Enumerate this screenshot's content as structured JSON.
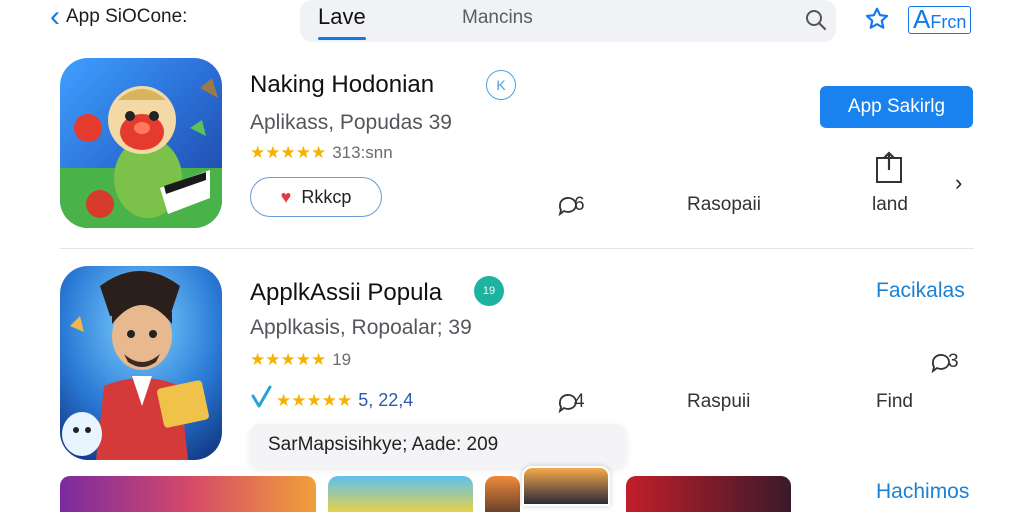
{
  "topbar": {
    "back_label": "App SiOCone:",
    "tabs": [
      {
        "label": "Lave",
        "active": true
      },
      {
        "label": "Mancins",
        "active": false
      }
    ],
    "afirm_big": "A",
    "afirm_small": "Frcn"
  },
  "apps": [
    {
      "title": "Naking Hodonian",
      "badge": "K",
      "subtitle": "Aplikass, Popudas 39",
      "stars": "★★★★★",
      "star_count": "313:snn",
      "fav_label": "Rkkcp",
      "comments": "6",
      "meta_mid": "Rasopaii",
      "meta_right": "land",
      "primary_button": "App Sakirlg"
    },
    {
      "title": "ApplkAssii Popula",
      "badge": "19",
      "subtitle": "Applkasis, Ropoalar; 39",
      "stars": "★★★★★",
      "star_count": "19",
      "rating_line_stars": "★★★★★",
      "rating_line_value": "5, 22,4",
      "comments": "4",
      "meta_mid": "Raspuii",
      "meta_right": "Find",
      "link_top": "Facikalas",
      "comments_right": "3",
      "tooltip": "SarMapsisihkye; Aade: 209"
    }
  ],
  "bottom": {
    "link": "Hachimos"
  },
  "colors": {
    "accent": "#1a82ee",
    "star": "#f5b301",
    "heart": "#e23a43",
    "badge_teal": "#1eb3a0"
  }
}
